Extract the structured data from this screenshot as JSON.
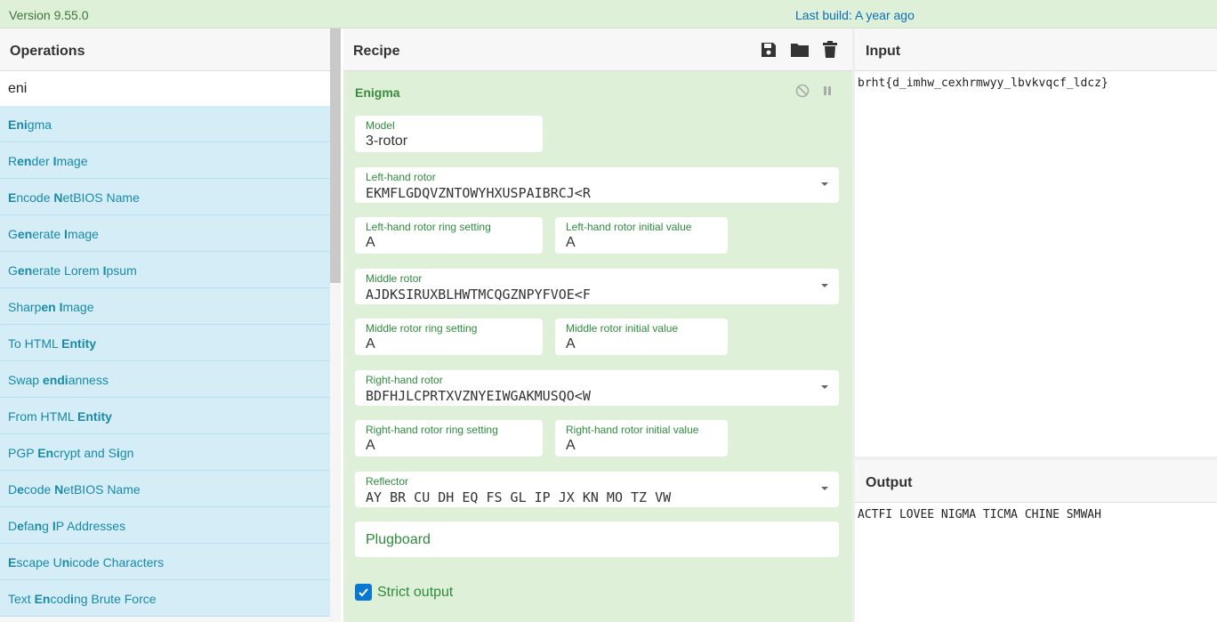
{
  "topbar": {
    "version": "Version 9.55.0",
    "last_build": "Last build: A year ago"
  },
  "operations": {
    "title": "Operations",
    "search_value": "eni",
    "items": [
      [
        [
          "Eni",
          1
        ],
        [
          "gma",
          0
        ]
      ],
      [
        [
          "R",
          0
        ],
        [
          "en",
          1
        ],
        [
          "der ",
          0
        ],
        [
          "I",
          1
        ],
        [
          "mage",
          0
        ]
      ],
      [
        [
          "E",
          1
        ],
        [
          "ncode ",
          0
        ],
        [
          "N",
          1
        ],
        [
          "etBIOS Name",
          0
        ]
      ],
      [
        [
          "G",
          0
        ],
        [
          "en",
          1
        ],
        [
          "erate ",
          0
        ],
        [
          "I",
          1
        ],
        [
          "mage",
          0
        ]
      ],
      [
        [
          "G",
          0
        ],
        [
          "en",
          1
        ],
        [
          "erate Lorem ",
          0
        ],
        [
          "I",
          1
        ],
        [
          "psum",
          0
        ]
      ],
      [
        [
          "Sharp",
          0
        ],
        [
          "en",
          1
        ],
        [
          " ",
          0
        ],
        [
          "I",
          1
        ],
        [
          "mage",
          0
        ]
      ],
      [
        [
          "To HTML ",
          0
        ],
        [
          "Entity",
          1
        ]
      ],
      [
        [
          "Swap ",
          0
        ],
        [
          "endi",
          1
        ],
        [
          "anness",
          0
        ]
      ],
      [
        [
          "From HTML ",
          0
        ],
        [
          "Entity",
          1
        ]
      ],
      [
        [
          "PGP ",
          0
        ],
        [
          "En",
          1
        ],
        [
          "crypt and S",
          0
        ],
        [
          "i",
          1
        ],
        [
          "gn",
          0
        ]
      ],
      [
        [
          "D",
          0
        ],
        [
          "e",
          1
        ],
        [
          "code ",
          0
        ],
        [
          "N",
          1
        ],
        [
          "etBIOS Name",
          0
        ]
      ],
      [
        [
          "D",
          0
        ],
        [
          "e",
          1
        ],
        [
          "fa",
          0
        ],
        [
          "n",
          1
        ],
        [
          "g ",
          0
        ],
        [
          "I",
          1
        ],
        [
          "P Addresses",
          0
        ]
      ],
      [
        [
          "E",
          1
        ],
        [
          "scape U",
          0
        ],
        [
          "n",
          1
        ],
        [
          "icode Characters",
          0
        ]
      ],
      [
        [
          "Text ",
          0
        ],
        [
          "En",
          1
        ],
        [
          "cod",
          0
        ],
        [
          "i",
          1
        ],
        [
          "ng Brute Force",
          0
        ]
      ]
    ]
  },
  "recipe": {
    "title": "Recipe",
    "toolbar_icons": [
      "save-icon",
      "folder-icon",
      "trash-icon"
    ],
    "ingredient": {
      "name": "Enigma",
      "model": {
        "label": "Model",
        "value": "3-rotor"
      },
      "left_rotor": {
        "label": "Left-hand rotor",
        "value": "EKMFLGDQVZNTOWYHXUSPAIBRCJ<R"
      },
      "left_ring": {
        "label": "Left-hand rotor ring setting",
        "value": "A"
      },
      "left_initial": {
        "label": "Left-hand rotor initial value",
        "value": "A"
      },
      "middle_rotor": {
        "label": "Middle rotor",
        "value": "AJDKSIRUXBLHWTMCQGZNPYFVOE<F"
      },
      "middle_ring": {
        "label": "Middle rotor ring setting",
        "value": "A"
      },
      "middle_initial": {
        "label": "Middle rotor initial value",
        "value": "A"
      },
      "right_rotor": {
        "label": "Right-hand rotor",
        "value": "BDFHJLCPRTXVZNYEIWGAKMUSQO<W"
      },
      "right_ring": {
        "label": "Right-hand rotor ring setting",
        "value": "A"
      },
      "right_initial": {
        "label": "Right-hand rotor initial value",
        "value": "A"
      },
      "reflector": {
        "label": "Reflector",
        "value": "AY BR CU DH EQ FS GL IP JX KN MO TZ VW"
      },
      "plugboard": {
        "label": "Plugboard",
        "value": ""
      },
      "strict_output": {
        "label": "Strict output",
        "checked": true
      }
    }
  },
  "input": {
    "title": "Input",
    "value": "brht{d_imhw_cexhrmwyy_lbvkvqcf_ldcz}"
  },
  "output": {
    "title": "Output",
    "value": "ACTFI LOVEE NIGMA TICMA CHINE SMWAH"
  },
  "colors": {
    "accent_green": "#3c8a3f",
    "ops_bg": "#d4edf7",
    "ops_text": "#1a89a8",
    "recipe_bg": "#dff0d8",
    "checkbox": "#0b78d0"
  }
}
